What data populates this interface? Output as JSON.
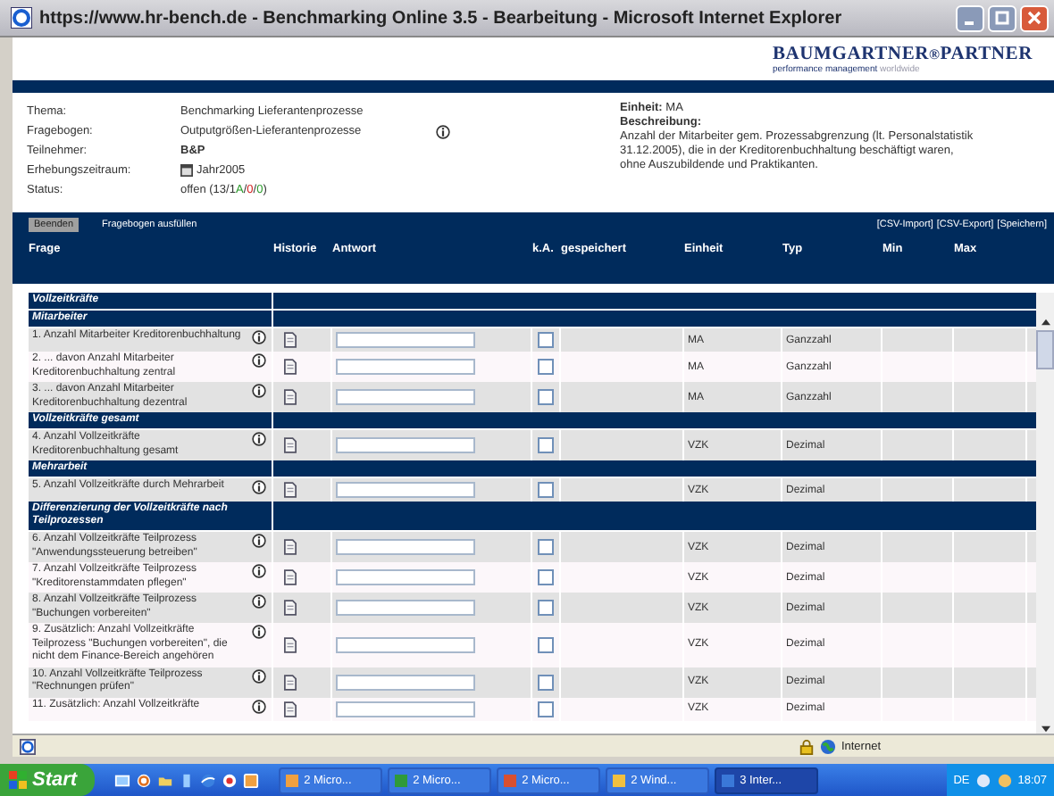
{
  "window": {
    "title": "https://www.hr-bench.de - Benchmarking Online 3.5 - Bearbeitung - Microsoft Internet Explorer"
  },
  "logo": {
    "name": "BAUMGARTNER",
    "sep": "®",
    "name2": "PARTNER",
    "tagline": "performance management",
    "tagline2": "worldwide"
  },
  "info": [
    {
      "label": "Thema:",
      "value": "Benchmarking Lieferantenprozesse",
      "kind": "text"
    },
    {
      "label": "Fragebogen:",
      "value": "Outputgrößen-Lieferantenprozesse",
      "kind": "info"
    },
    {
      "label": "Teilnehmer:",
      "value": "B&P",
      "kind": "bold"
    },
    {
      "label": "Erhebungszeitraum:",
      "value": "Jahr2005",
      "kind": "calendar"
    },
    {
      "label": "Status:",
      "value": "offen (13/1",
      "kind": "status",
      "parts": [
        {
          "text": "A",
          "color": "#2a9a2a"
        },
        {
          "text": "/"
        },
        {
          "text": "0",
          "color": "#d02020"
        },
        {
          "text": "/"
        },
        {
          "text": "0",
          "color": "#2a9a2a"
        },
        {
          "text": ")"
        }
      ]
    }
  ],
  "detail": {
    "unit_label": "Einheit:",
    "unit": "MA",
    "desc_label": "Beschreibung:",
    "desc": "Anzahl der Mitarbeiter gem. Prozessabgrenzung (lt. Personalstatistik 31.12.2005), die in der Kreditorenbuchhaltung beschäftigt waren, ohne Auszubildende und Praktikanten."
  },
  "toolbar": {
    "left": [
      {
        "label": "Beenden",
        "selected": true
      },
      {
        "label": "Fragebogen ausfüllen",
        "selected": false
      }
    ],
    "right": [
      "[CSV-Import]",
      "[CSV-Export]",
      "[Speichern]"
    ]
  },
  "columns": [
    "Frage",
    "Historie",
    "Antwort",
    "k.A.",
    "gespeichert",
    "Einheit",
    "Typ",
    "Min",
    "Max"
  ],
  "rows": [
    {
      "kind": "group",
      "label": "Vollzeitkräfte"
    },
    {
      "kind": "group",
      "label": "Mitarbeiter"
    },
    {
      "kind": "item",
      "label": "1. Anzahl Mitarbeiter Kreditorenbuchhaltung",
      "checked": false,
      "unit": "MA",
      "type": "Ganzzahl"
    },
    {
      "kind": "item",
      "label": "2. ... davon Anzahl Mitarbeiter Kreditorenbuchhaltung zentral",
      "checked": false,
      "unit": "MA",
      "type": "Ganzzahl"
    },
    {
      "kind": "item",
      "label": "3. ... davon Anzahl Mitarbeiter Kreditorenbuchhaltung dezentral",
      "checked": false,
      "unit": "MA",
      "type": "Ganzzahl"
    },
    {
      "kind": "group",
      "label": "Vollzeitkräfte gesamt"
    },
    {
      "kind": "item",
      "label": "4. Anzahl Vollzeitkräfte Kreditorenbuchhaltung gesamt",
      "checked": false,
      "unit": "VZK",
      "type": "Dezimal"
    },
    {
      "kind": "group",
      "label": "Mehrarbeit"
    },
    {
      "kind": "item",
      "label": "5. Anzahl Vollzeitkräfte durch Mehrarbeit",
      "checked": false,
      "unit": "VZK",
      "type": "Dezimal"
    },
    {
      "kind": "group",
      "label": "Differenzierung der Vollzeitkräfte nach Teilprozessen"
    },
    {
      "kind": "item",
      "label": "6. Anzahl Vollzeitkräfte Teilprozess \"Anwendungssteuerung betreiben\"",
      "checked": false,
      "unit": "VZK",
      "type": "Dezimal"
    },
    {
      "kind": "item",
      "label": "7. Anzahl Vollzeitkräfte Teilprozess \"Kreditorenstammdaten pflegen\"",
      "checked": false,
      "unit": "VZK",
      "type": "Dezimal"
    },
    {
      "kind": "item",
      "label": "8. Anzahl Vollzeitkräfte Teilprozess \"Buchungen vorbereiten\"",
      "checked": false,
      "unit": "VZK",
      "type": "Dezimal"
    },
    {
      "kind": "item",
      "label": "9. Zusätzlich: Anzahl Vollzeitkräfte Teilprozess \"Buchungen vorbereiten\", die nicht dem Finance-Bereich angehören",
      "checked": false,
      "unit": "VZK",
      "type": "Dezimal"
    },
    {
      "kind": "item",
      "label": "10. Anzahl Vollzeitkräfte Teilprozess \"Rechnungen prüfen\"",
      "checked": false,
      "unit": "VZK",
      "type": "Dezimal"
    },
    {
      "kind": "item",
      "label": "11. Zusätzlich: Anzahl Vollzeitkräfte",
      "checked": false,
      "unit": "VZK",
      "type": "Dezimal"
    }
  ],
  "status_bar": {
    "zone": "Internet"
  },
  "taskbar": {
    "start": "Start",
    "tasks": [
      {
        "label": "2 Micro...",
        "selected": false,
        "color": "#f0a040"
      },
      {
        "label": "2 Micro...",
        "selected": false,
        "color": "#2f9a3a"
      },
      {
        "label": "2 Micro...",
        "selected": false,
        "color": "#d85030"
      },
      {
        "label": "2 Wind...",
        "selected": false,
        "color": "#f0c040"
      },
      {
        "label": "3 Inter...",
        "selected": true,
        "color": "#3a78d8"
      }
    ],
    "lang": "DE",
    "clock": "18:07"
  }
}
